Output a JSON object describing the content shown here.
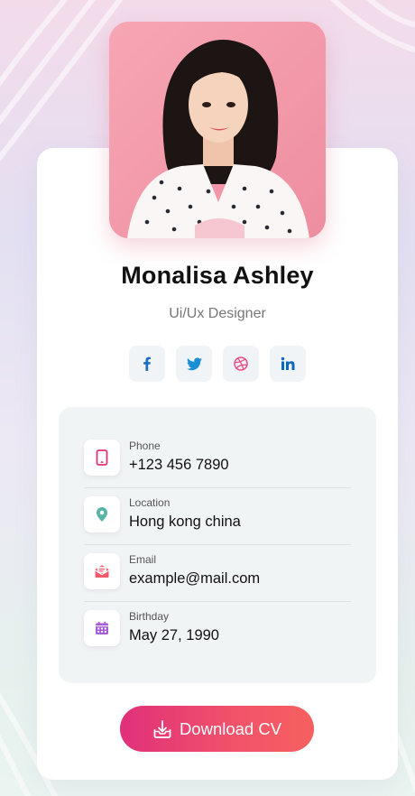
{
  "profile": {
    "name": "Monalisa Ashley",
    "role": "Ui/Ux Designer",
    "avatar_icon": "portrait-photo"
  },
  "socials": [
    {
      "name": "facebook",
      "icon": "facebook-icon",
      "color": "#1b6fc2"
    },
    {
      "name": "twitter",
      "icon": "twitter-icon",
      "color": "#1b8fd6"
    },
    {
      "name": "dribbble",
      "icon": "dribbble-icon",
      "color": "#ea4c89"
    },
    {
      "name": "linkedin",
      "icon": "linkedin-icon",
      "color": "#0a66c2"
    }
  ],
  "info": {
    "phone": {
      "label": "Phone",
      "value": "+123 456 7890",
      "icon": "phone-icon",
      "color": "#e0307a"
    },
    "location": {
      "label": "Location",
      "value": "Hong kong china",
      "icon": "location-pin-icon",
      "color": "#56b5a8"
    },
    "email": {
      "label": "Email",
      "value": "example@mail.com",
      "icon": "mail-icon",
      "color": "#f05a6b"
    },
    "birthday": {
      "label": "Birthday",
      "value": "May 27, 1990",
      "icon": "calendar-icon",
      "color": "#a55fd6"
    }
  },
  "actions": {
    "download_label": "Download CV",
    "download_icon": "download-icon"
  },
  "colors": {
    "accent_start": "#e0307a",
    "accent_end": "#f5605f",
    "panel_bg": "#f1f4f5"
  }
}
